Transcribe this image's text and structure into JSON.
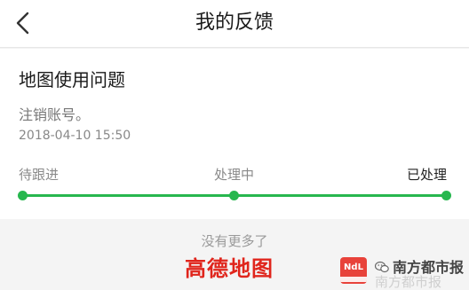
{
  "header": {
    "title": "我的反馈"
  },
  "feedback": {
    "title": "地图使用问题",
    "content": "注销账号。",
    "time": "2018-04-10 15:50",
    "steps": [
      "待跟进",
      "处理中",
      "已处理"
    ],
    "current_step": 3,
    "accent_color": "#27b74e"
  },
  "footer": {
    "end_message": "没有更多了",
    "brand": "高德地图"
  },
  "watermark": {
    "logo_icon": "nandu-logo",
    "wechat_icon": "wechat-icon",
    "name": "南方都市报",
    "name_overlay": "南方都市报"
  }
}
